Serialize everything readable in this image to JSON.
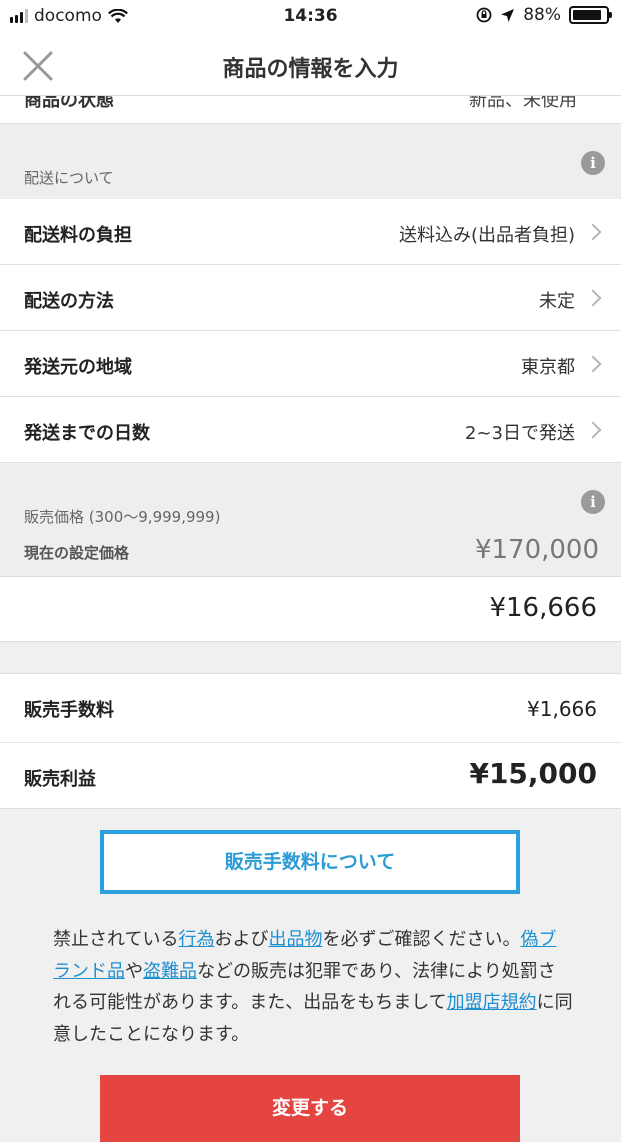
{
  "status_bar": {
    "carrier": "docomo",
    "time": "14:36",
    "battery": "88%",
    "battery_level": 0.88
  },
  "nav": {
    "title": "商品の情報を入力"
  },
  "cut_row": {
    "label": "商品の状態",
    "value": "新品、未使用"
  },
  "shipping": {
    "section_label": "配送について",
    "rows": [
      {
        "label": "配送料の負担",
        "value": "送料込み(出品者負担)"
      },
      {
        "label": "配送の方法",
        "value": "未定"
      },
      {
        "label": "発送元の地域",
        "value": "東京都"
      },
      {
        "label": "発送までの日数",
        "value": "2~3日で発送"
      }
    ]
  },
  "price": {
    "section_label": "販売価格 (300〜9,999,999)",
    "current_label": "現在の設定価格",
    "current_value": "¥170,000",
    "input_value": "¥16,666"
  },
  "fees": {
    "fee_label": "販売手数料",
    "fee_value": "¥1,666",
    "profit_label": "販売利益",
    "profit_value": "¥15,000"
  },
  "fee_button_label": "販売手数料について",
  "notice": {
    "t1": "禁止されている",
    "link1": "行為",
    "t2": "および",
    "link2": "出品物",
    "t3": "を必ずご確認ください。",
    "link3": "偽ブランド品",
    "t4": "や",
    "link4": "盗難品",
    "t5": "などの販売は犯罪であり、法律により処罰される可能性があります。また、出品をもちまして",
    "link5": "加盟店規約",
    "t6": "に同意したことになります。"
  },
  "submit_label": "変更する",
  "colors": {
    "accent_blue": "#2aa0dc",
    "submit_red": "#e54540"
  }
}
